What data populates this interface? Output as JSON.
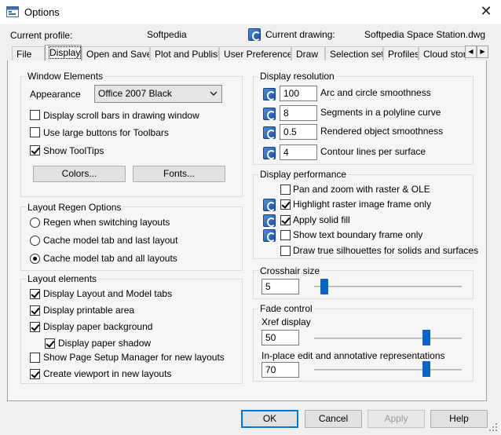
{
  "window": {
    "title": "Options",
    "close_label": "✕"
  },
  "header": {
    "profile_label": "Current profile:",
    "profile_value": "Softpedia",
    "drawing_label": "Current drawing:",
    "drawing_value": "Softpedia Space Station.dwg"
  },
  "tabs": [
    {
      "label": "File"
    },
    {
      "label": "Display"
    },
    {
      "label": "Open and Save"
    },
    {
      "label": "Plot and Publish"
    },
    {
      "label": "User Preferences"
    },
    {
      "label": "Draw"
    },
    {
      "label": "Selection set"
    },
    {
      "label": "Profiles"
    },
    {
      "label": "Cloud stora"
    }
  ],
  "active_tab": "Display",
  "window_elements": {
    "title": "Window Elements",
    "appearance_label": "Appearance",
    "appearance_value": "Office 2007 Black",
    "checkboxes": [
      {
        "label": "Display scroll bars in drawing window",
        "checked": false
      },
      {
        "label": "Use large buttons for Toolbars",
        "checked": false
      },
      {
        "label": "Show ToolTips",
        "checked": true
      }
    ],
    "colors_button": "Colors...",
    "fonts_button": "Fonts..."
  },
  "layout_regen": {
    "title": "Layout Regen Options",
    "options": [
      {
        "label": "Regen when switching layouts",
        "selected": false
      },
      {
        "label": "Cache model tab and last layout",
        "selected": false
      },
      {
        "label": "Cache model tab and all layouts",
        "selected": true
      }
    ]
  },
  "layout_elements": {
    "title": "Layout elements",
    "items": [
      {
        "label": "Display Layout and Model tabs",
        "checked": true
      },
      {
        "label": "Display printable area",
        "checked": true
      },
      {
        "label": "Display paper background",
        "checked": true
      },
      {
        "label": "Display paper shadow",
        "checked": true
      },
      {
        "label": "Show Page Setup Manager for new layouts",
        "checked": false
      },
      {
        "label": "Create viewport in new layouts",
        "checked": true
      }
    ]
  },
  "display_resolution": {
    "title": "Display resolution",
    "rows": [
      {
        "value": "100",
        "label": "Arc and circle smoothness"
      },
      {
        "value": "8",
        "label": "Segments in a polyline curve"
      },
      {
        "value": "0.5",
        "label": "Rendered object smoothness"
      },
      {
        "value": "4",
        "label": "Contour lines per surface"
      }
    ]
  },
  "display_performance": {
    "title": "Display performance",
    "items": [
      {
        "label": "Pan and zoom with raster & OLE",
        "checked": false,
        "icon": false
      },
      {
        "label": "Highlight raster image frame only",
        "checked": true,
        "icon": true
      },
      {
        "label": "Apply solid fill",
        "checked": true,
        "icon": true
      },
      {
        "label": "Show text boundary frame only",
        "checked": false,
        "icon": true
      },
      {
        "label": "Draw true silhouettes for solids and surfaces",
        "checked": false,
        "icon": false
      }
    ]
  },
  "crosshair": {
    "title": "Crosshair size",
    "value": "5",
    "level_percent": 5
  },
  "fade_control": {
    "title": "Fade control",
    "xref_label": "Xref display",
    "xref_value": "50",
    "xref_level_percent": 50,
    "inplace_label": "In-place edit and annotative representations",
    "inplace_value": "70",
    "inplace_level_percent": 70
  },
  "buttons": {
    "ok": "OK",
    "cancel": "Cancel",
    "apply": "Apply",
    "help": "Help"
  },
  "icon_names": {
    "drawing": "drawing-icon",
    "saved_in_drawing": "saved-in-drawing-icon"
  }
}
